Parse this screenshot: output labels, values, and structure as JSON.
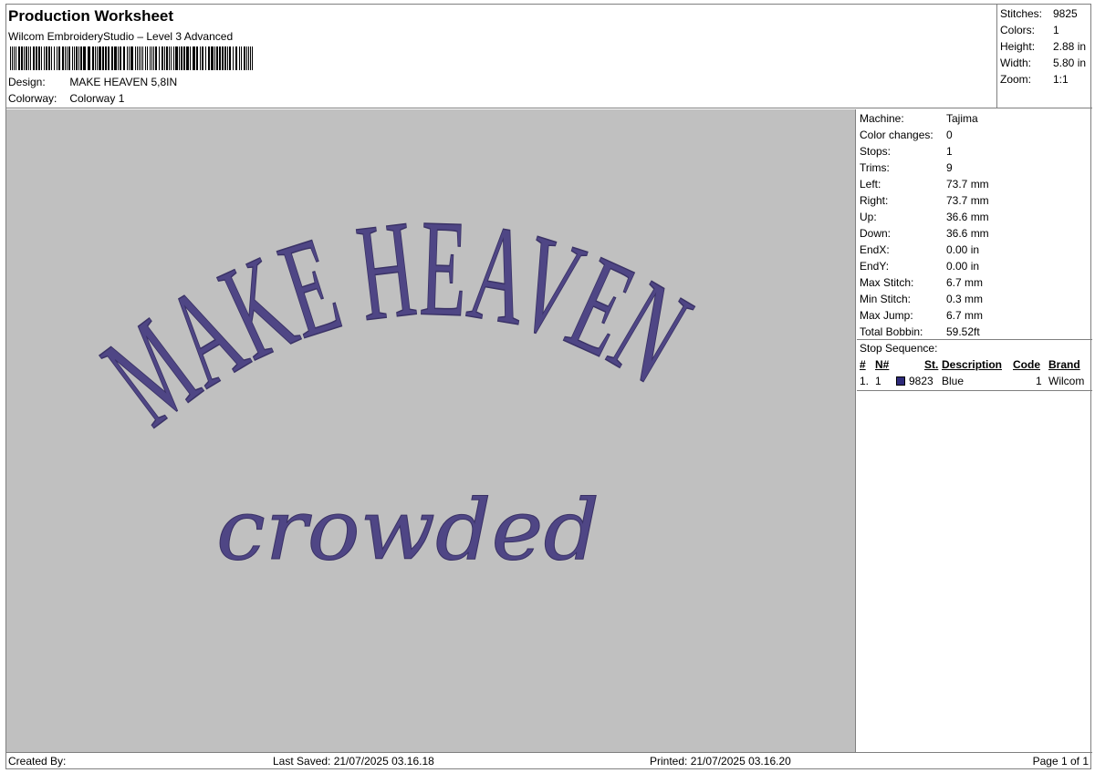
{
  "header": {
    "title": "Production Worksheet",
    "software": "Wilcom EmbroideryStudio – Level 3 Advanced",
    "design_label": "Design:",
    "design_value": "MAKE HEAVEN 5,8IN",
    "colorway_label": "Colorway:",
    "colorway_value": "Colorway 1"
  },
  "summary": {
    "stitches_label": "Stitches:",
    "stitches_value": "9825",
    "colors_label": "Colors:",
    "colors_value": "1",
    "height_label": "Height:",
    "height_value": "2.88 in",
    "width_label": "Width:",
    "width_value": "5.80 in",
    "zoom_label": "Zoom:",
    "zoom_value": "1:1"
  },
  "design_preview": {
    "line1": "MAKE HEAVEN",
    "line2": "crowded",
    "thread_color": "#4f4685",
    "background_color": "#c0c0c0"
  },
  "details": {
    "machine_label": "Machine:",
    "machine_value": "Tajima",
    "color_changes_label": "Color changes:",
    "color_changes_value": "0",
    "stops_label": "Stops:",
    "stops_value": "1",
    "trims_label": "Trims:",
    "trims_value": "9",
    "left_label": "Left:",
    "left_value": "73.7 mm",
    "right_label": "Right:",
    "right_value": "73.7 mm",
    "up_label": "Up:",
    "up_value": "36.6 mm",
    "down_label": "Down:",
    "down_value": "36.6 mm",
    "endx_label": "EndX:",
    "endx_value": "0.00 in",
    "endy_label": "EndY:",
    "endy_value": "0.00 in",
    "max_stitch_label": "Max Stitch:",
    "max_stitch_value": "6.7 mm",
    "min_stitch_label": "Min Stitch:",
    "min_stitch_value": "0.3 mm",
    "max_jump_label": "Max Jump:",
    "max_jump_value": "6.7 mm",
    "total_bobbin_label": "Total Bobbin:",
    "total_bobbin_value": "59.52ft"
  },
  "stop_sequence": {
    "title": "Stop Sequence:",
    "headers": {
      "index": "#",
      "needle": "N#",
      "stitches": "St.",
      "description": "Description",
      "code": "Code",
      "brand": "Brand"
    },
    "rows": [
      {
        "index": "1.",
        "needle": "1",
        "swatch_color": "#2e2a7a",
        "stitches": "9823",
        "description": "Blue",
        "code": "1",
        "brand": "Wilcom"
      }
    ]
  },
  "footer": {
    "created_by": "Created By:",
    "last_saved": "Last Saved: 21/07/2025 03.16.18",
    "printed": "Printed: 21/07/2025 03.16.20",
    "page": "Page 1 of 1"
  }
}
